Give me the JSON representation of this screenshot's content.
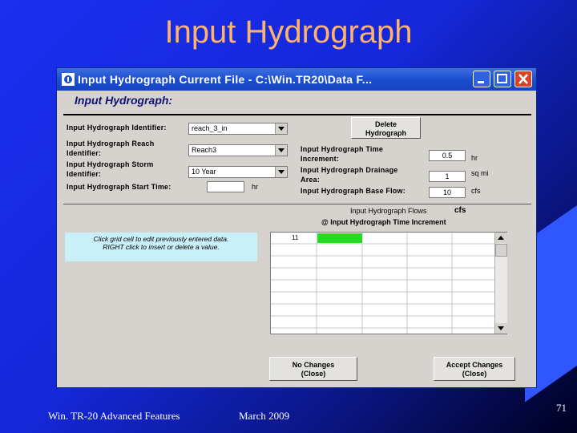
{
  "slide": {
    "title": "Input Hydrograph",
    "footer_left": "Win. TR-20 Advanced Features",
    "footer_date": "March 2009",
    "page_number": "71"
  },
  "window": {
    "title": "Input Hydrograph   Current File - C:\\Win.TR20\\Data F...",
    "form_heading": "Input Hydrograph:",
    "identifier_label": "Input Hydrograph Identifier:",
    "identifier_value": "reach_3_in",
    "reach_label_1": "Input Hydrograph Reach",
    "reach_label_2": "Identifier:",
    "reach_value": "Reach3",
    "storm_label_1": "Input Hydrograph Storm",
    "storm_label_2": "Identifier:",
    "storm_value": "10 Year",
    "start_label": "Input Hydrograph Start Time:",
    "start_value": "",
    "start_unit": "hr",
    "delete_button_1": "Delete",
    "delete_button_2": "Hydrograph",
    "increment_label_1": "Input Hydrograph Time",
    "increment_label_2": "Increment:",
    "increment_value": "0.5",
    "increment_unit": "hr",
    "drainage_label_1": "Input Hydrograph Drainage",
    "drainage_label_2": "Area:",
    "drainage_value": "1",
    "drainage_unit": "sq mi",
    "baseflow_label": "Input Hydrograph Base Flow:",
    "baseflow_value": "10",
    "baseflow_unit": "cfs",
    "grid_title_1": "Input Hydrograph Flows",
    "grid_title_unit": "cfs",
    "grid_title_2": "@ Input Hydrograph Time Increment",
    "grid_first_cell": "11",
    "note_line_1": "Click grid cell to edit previously entered data.",
    "note_line_2": "RIGHT click to insert or delete  a value.",
    "no_changes_1": "No Changes",
    "no_changes_2": "(Close)",
    "accept_1": "Accept Changes",
    "accept_2": "(Close)"
  },
  "colors": {
    "title": "#ffb26b",
    "titlebar": "#1b4fd0",
    "grid_highlight": "#22dd22",
    "note_bg": "#c9f0f8"
  }
}
